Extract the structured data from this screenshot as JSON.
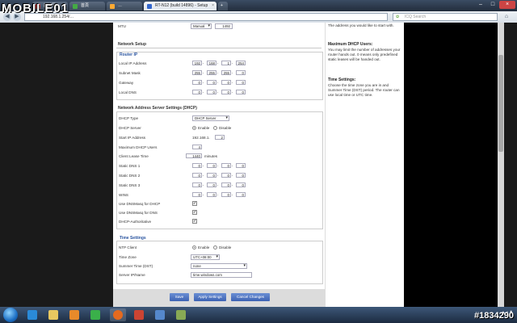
{
  "browser": {
    "tabs": [
      {
        "label": "討論區…"
      },
      {
        "label": "首頁"
      },
      {
        "label": "…"
      },
      {
        "label": "RT-N12 (build 14896) - Setup"
      }
    ],
    "url": "192.168.1.254/…",
    "search_placeholder": "ICQ Search"
  },
  "logo_text": "MOBILE01",
  "top": {
    "mtu_label": "MTU",
    "mtu_mode": "Manual",
    "mtu_value": "1492"
  },
  "network_setup": {
    "title": "Network Setup",
    "router_ip": {
      "title": "Router IP",
      "local_ip_label": "Local IP Address",
      "local_ip": [
        "192",
        "168",
        "1",
        "254"
      ],
      "subnet_label": "Subnet Mask",
      "subnet": [
        "255",
        "255",
        "255",
        "0"
      ],
      "gateway_label": "Gateway",
      "gateway": [
        "0",
        "0",
        "0",
        "0"
      ],
      "local_dns_label": "Local DNS",
      "local_dns": [
        "0",
        "0",
        "0",
        "0"
      ]
    }
  },
  "dhcp": {
    "title": "Network Address Server Settings (DHCP)",
    "type_label": "DHCP Type",
    "type_value": "DHCP Server",
    "server_label": "DHCP Server",
    "enable_label": "Enable",
    "disable_label": "Disable",
    "start_ip_label": "Start IP Address",
    "start_ip_prefix": "192.168.1.",
    "start_ip_last": "2",
    "max_users_label": "Maximum DHCP Users",
    "max_users": "4",
    "lease_label": "Client Lease Time",
    "lease_value": "1440",
    "lease_unit": "minutes",
    "dns1_label": "Static DNS 1",
    "dns1": [
      "0",
      "0",
      "0",
      "0"
    ],
    "dns2_label": "Static DNS 2",
    "dns2": [
      "0",
      "0",
      "0",
      "0"
    ],
    "dns3_label": "Static DNS 3",
    "dns3": [
      "0",
      "0",
      "0",
      "0"
    ],
    "wins_label": "WINS",
    "wins": [
      "0",
      "0",
      "0",
      "0"
    ],
    "dnsmasq_dhcp_label": "Use DNSMasq for DHCP",
    "dnsmasq_dns_label": "Use DNSMasq for DNS",
    "authoritative_label": "DHCP-Authoritative"
  },
  "time": {
    "title": "Time Settings",
    "ntp_label": "NTP Client",
    "enable_label": "Enable",
    "disable_label": "Disable",
    "zone_label": "Time Zone",
    "zone_value": "UTC+08:00",
    "dst_label": "Summer Time (DST)",
    "dst_value": "none",
    "server_label": "Server IP/Name",
    "server_value": "time.windows.com"
  },
  "buttons": {
    "save": "Save",
    "apply": "Apply Settings",
    "cancel": "Cancel Changes"
  },
  "help": {
    "intro": "The address you would like to start with.",
    "max_title": "Maximum DHCP Users:",
    "max_text": "You may limit the number of addresses your router hands out. 0 means only predefined static leases will be handed out.",
    "time_title": "Time Settings:",
    "time_text": "Choose the time zone you are in and Summer Time (DST) period. The router can use local time or UTC time."
  },
  "watermark": "#1834290"
}
